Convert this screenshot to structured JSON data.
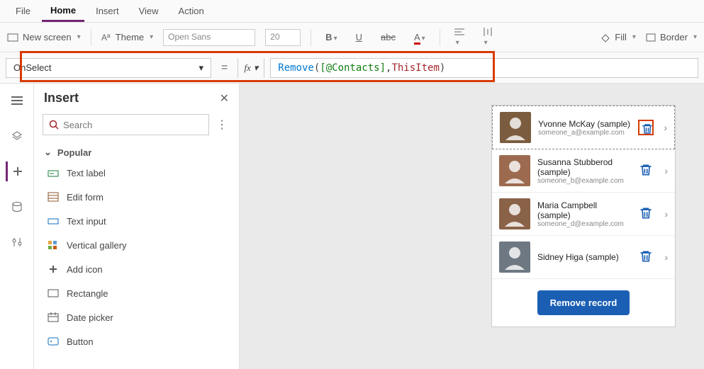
{
  "menu": {
    "file": "File",
    "home": "Home",
    "insert": "Insert",
    "view": "View",
    "action": "Action"
  },
  "ribbon": {
    "new_screen": "New screen",
    "theme": "Theme",
    "font_family": "Open Sans",
    "font_size": "20",
    "fill": "Fill",
    "border": "Border"
  },
  "formula": {
    "property": "OnSelect",
    "fx_label": "fx",
    "fn": "Remove",
    "open": "( ",
    "datasource": "[@Contacts]",
    "comma": ", ",
    "item": "ThisItem",
    "close": " )"
  },
  "insert_panel": {
    "title": "Insert",
    "search_placeholder": "Search",
    "section": "Popular",
    "items": [
      {
        "label": "Text label"
      },
      {
        "label": "Edit form"
      },
      {
        "label": "Text input"
      },
      {
        "label": "Vertical gallery"
      },
      {
        "label": "Add icon"
      },
      {
        "label": "Rectangle"
      },
      {
        "label": "Date picker"
      },
      {
        "label": "Button"
      }
    ]
  },
  "contacts": [
    {
      "name": "Yvonne McKay (sample)",
      "email": "someone_a@example.com",
      "selected": true
    },
    {
      "name": "Susanna Stubberod (sample)",
      "email": "someone_b@example.com",
      "selected": false
    },
    {
      "name": "Maria Campbell (sample)",
      "email": "someone_d@example.com",
      "selected": false
    },
    {
      "name": "Sidney Higa (sample)",
      "email": "",
      "selected": false
    }
  ],
  "remove_button": "Remove record"
}
